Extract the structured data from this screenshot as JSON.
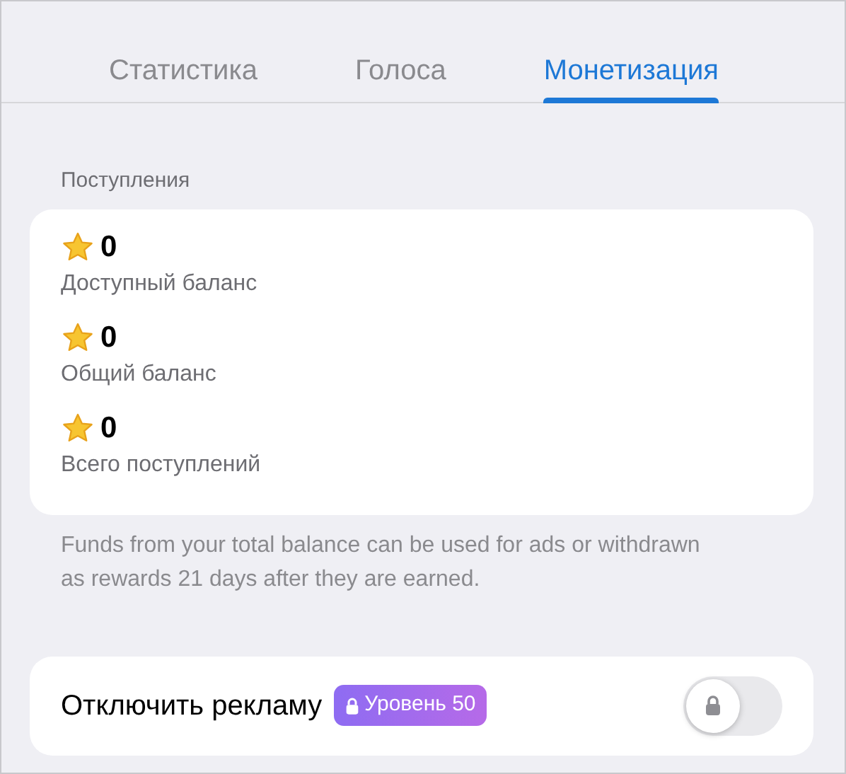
{
  "tabs": [
    {
      "label": "Статистика",
      "selected": false
    },
    {
      "label": "Голоса",
      "selected": false
    },
    {
      "label": "Монетизация",
      "selected": true
    }
  ],
  "section_title": "Поступления",
  "balances": [
    {
      "value": "0",
      "label": "Доступный баланс"
    },
    {
      "value": "0",
      "label": "Общий баланс"
    },
    {
      "value": "0",
      "label": "Всего поступлений"
    }
  ],
  "footnote": "Funds from your total balance can be used for ads or withdrawn as rewards 21 days after they are earned.",
  "setting": {
    "label": "Отключить рекламу",
    "badge": "Уровень 50",
    "on": false,
    "locked": true
  }
}
